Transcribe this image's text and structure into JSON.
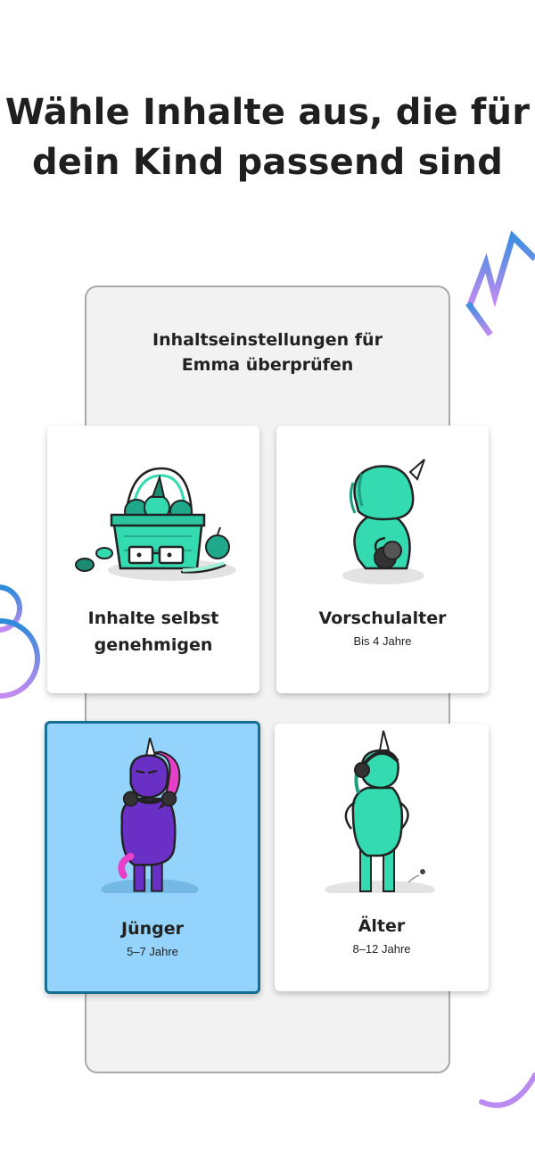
{
  "headline": {
    "line1": "Wähle Inhalte aus, die für",
    "line2": "dein Kind passend sind"
  },
  "settings_panel": {
    "title_line1": "Inhaltseinstellungen für",
    "title_line2": "Emma überprüfen"
  },
  "options": [
    {
      "name_line1": "Inhalte selbst",
      "name_line2": "genehmigen",
      "icon": "fruit-basket-with-glasses-icon",
      "selected": false
    },
    {
      "name": "Vorschulalter",
      "age": "Bis 4 Jahre",
      "icon": "small-unicorn-with-headphones-icon",
      "selected": false
    },
    {
      "name": "Jünger",
      "age": "5–7 Jahre",
      "icon": "purple-unicorn-with-headphones-icon",
      "selected": true
    },
    {
      "name": "Älter",
      "age": "8–12 Jahre",
      "icon": "teal-unicorn-with-headphones-icon",
      "selected": false
    }
  ],
  "colors": {
    "selected_card_bg": "#94d4fc",
    "selected_card_border": "#166f8f",
    "mascot_teal": "#34dbb0",
    "mascot_purple": "#6a2fc4",
    "mane_pink": "#e83fc8"
  }
}
